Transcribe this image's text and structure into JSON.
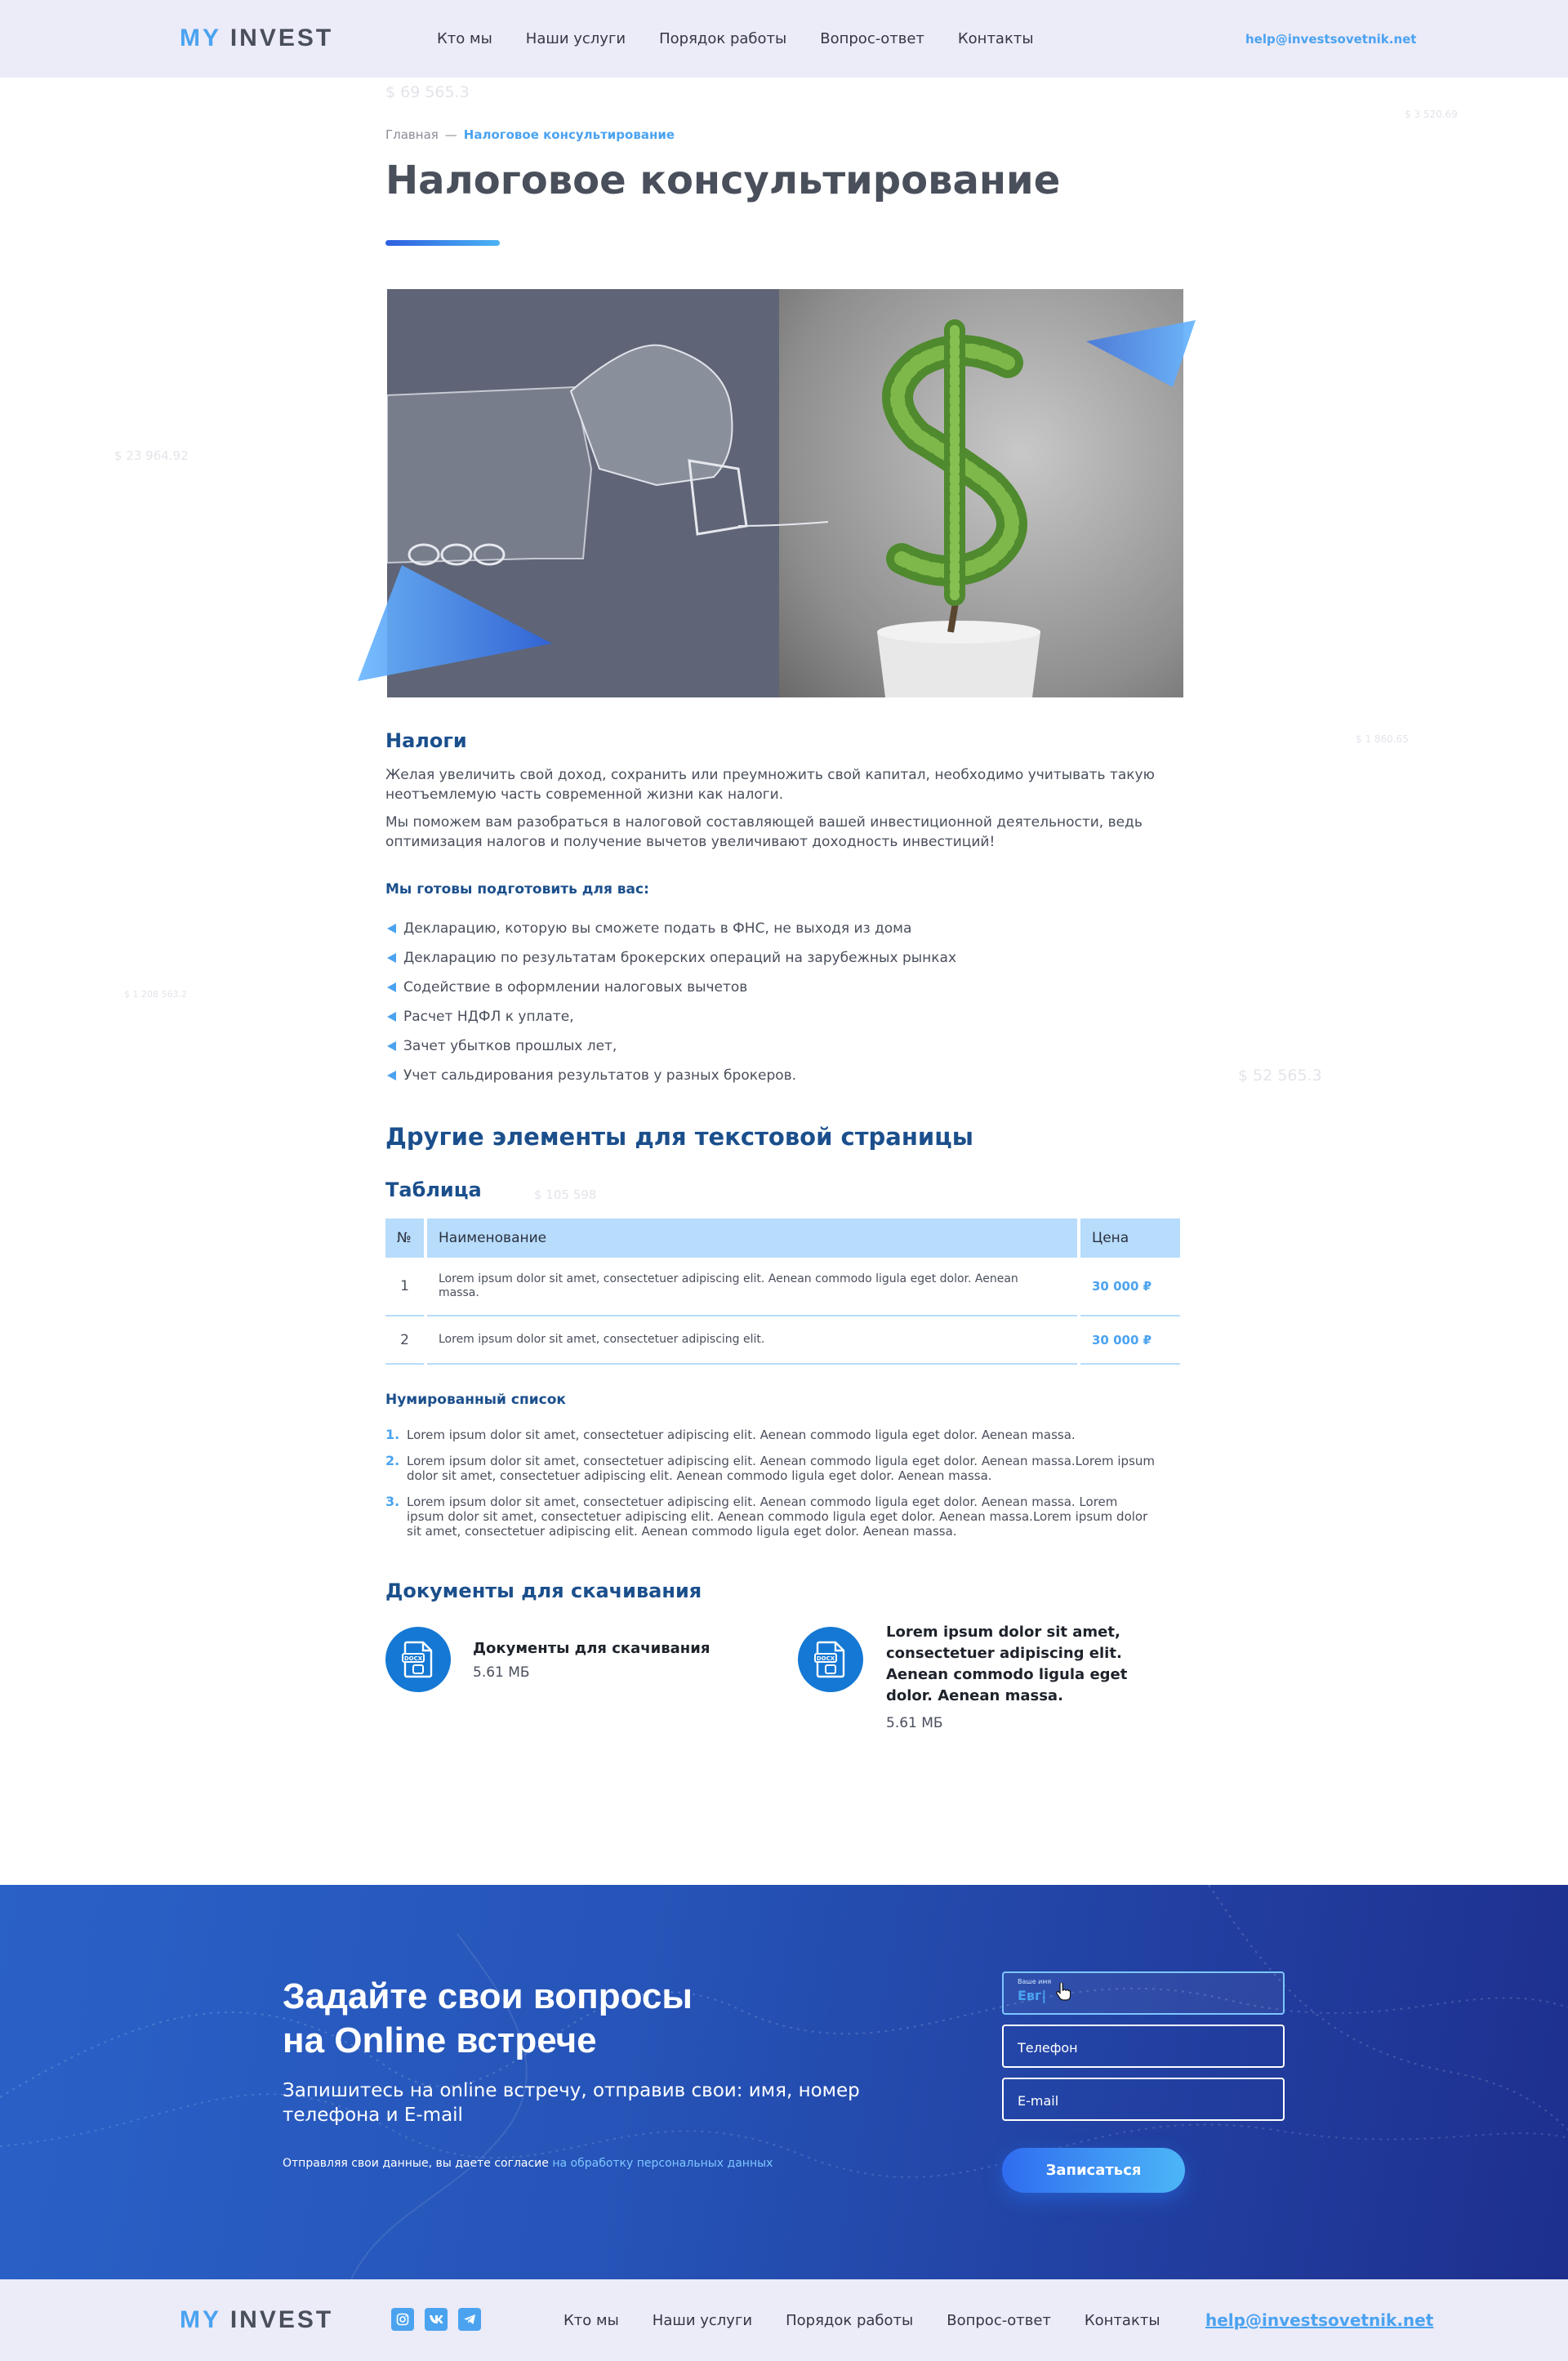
{
  "brand": {
    "part1": "MY",
    "part2": "INVEST"
  },
  "header": {
    "nav": [
      "Кто мы",
      "Наши услуги",
      "Порядок работы",
      "Вопрос-ответ",
      "Контакты"
    ],
    "email": "help@investsovetnik.net"
  },
  "background_numbers": [
    "$ 69 565.3",
    "$ 3 520.69",
    "$ 23 964.92",
    "$ 1 860.65",
    "$ 1 208 563.2",
    "$ 52 565.3",
    "$ 105 598"
  ],
  "breadcrumb": {
    "home": "Главная",
    "separator": "—",
    "current": "Налоговое консультирование"
  },
  "page_title": "Налоговое консультирование",
  "taxes": {
    "heading": "Налоги",
    "paragraphs": [
      "Желая увеличить свой доход, сохранить или преумножить свой капитал, необходимо учитывать такую неотъемлемую часть современной жизни как налоги.",
      "Мы поможем вам разобраться в налоговой составляющей вашей инвестиционной деятельности, ведь оптимизация налогов и получение вычетов увеличивают доходность инвестиций!"
    ],
    "ready_heading": "Мы готовы подготовить для вас:",
    "items": [
      "Декларацию, которую вы сможете подать в ФНС, не выходя из дома",
      "Декларацию по результатам брокерских операций на зарубежных рынках",
      "Содействие в оформлении налоговых вычетов",
      "Расчет НДФЛ к уплате,",
      "Зачет убытков прошлых лет,",
      "Учет сальдирования результатов у разных брокеров."
    ]
  },
  "other_heading": "Другие элементы для текстовой страницы",
  "table": {
    "heading": "Таблица",
    "columns": [
      "№",
      "Наименование",
      "Цена"
    ],
    "rows": [
      {
        "num": "1",
        "name": "Lorem ipsum dolor sit amet, consectetuer adipiscing elit. Aenean commodo ligula eget dolor. Aenean massa.",
        "price": "30 000 ₽"
      },
      {
        "num": "2",
        "name": "Lorem ipsum dolor sit amet, consectetuer adipiscing elit.",
        "price": "30 000 ₽"
      }
    ]
  },
  "numbered": {
    "heading": "Нумированный список",
    "items": [
      {
        "n": "1.",
        "text": "Lorem ipsum dolor sit amet, consectetuer adipiscing elit. Aenean commodo ligula eget dolor. Aenean massa."
      },
      {
        "n": "2.",
        "text": "Lorem ipsum dolor sit amet, consectetuer adipiscing elit. Aenean commodo ligula eget dolor. Aenean massa.Lorem ipsum dolor sit amet, consectetuer adipiscing elit. Aenean commodo ligula eget dolor. Aenean massa."
      },
      {
        "n": "3.",
        "text": "Lorem ipsum dolor sit amet, consectetuer adipiscing elit. Aenean commodo ligula eget dolor. Aenean massa. Lorem ipsum dolor sit amet, consectetuer adipiscing elit. Aenean commodo ligula eget dolor. Aenean massa.Lorem ipsum dolor sit amet, consectetuer adipiscing elit. Aenean commodo ligula eget dolor. Aenean massa."
      }
    ]
  },
  "documents": {
    "heading": "Документы для скачивания",
    "items": [
      {
        "title": "Документы для скачивания",
        "size": "5.61 МБ",
        "icon": "docx-file-icon"
      },
      {
        "title": "Lorem ipsum dolor sit amet, consectetuer adipiscing elit. Aenean commodo ligula eget dolor. Aenean massa.",
        "size": "5.61 МБ",
        "icon": "docx-file-icon"
      }
    ]
  },
  "cta": {
    "title_line1": "Задайте свои вопросы",
    "title_line2": "на Online встрече",
    "subtitle": "Запишитесь на online встречу, отправив свои: имя, номер телефона и E-mail",
    "note": "Отправляя свои данные, вы даете согласие",
    "note_link": "на обработку персональных данных",
    "name_label": "Ваше имя",
    "name_value": "Евг|",
    "phone_placeholder": "Телефон",
    "email_placeholder": "E-mail",
    "submit": "Записаться"
  },
  "footer": {
    "nav": [
      "Кто мы",
      "Наши услуги",
      "Порядок работы",
      "Вопрос-ответ",
      "Контакты"
    ],
    "email": "help@investsovetnik.net",
    "socials": [
      "instagram-icon",
      "vk-icon",
      "telegram-icon"
    ]
  },
  "colors": {
    "accent": "#4ba3f0",
    "heading": "#1b4f8c",
    "text": "#4a4f5c",
    "header_bg": "#ecebf8",
    "cta_start": "#2a61c7",
    "cta_end": "#1e2f8e",
    "table_header": "#b8dcfb"
  }
}
